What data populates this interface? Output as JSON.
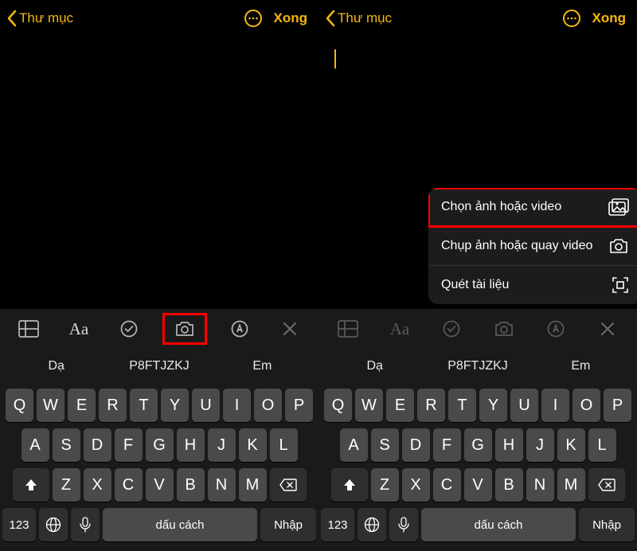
{
  "nav": {
    "back_label": "Thư mục",
    "done_label": "Xong"
  },
  "menu": {
    "item1": "Chọn ảnh hoặc video",
    "item2": "Chụp ảnh hoặc quay video",
    "item3": "Quét tài liệu"
  },
  "toolbar": {
    "aa": "Aa"
  },
  "suggest": {
    "left": "Dạ",
    "mid": "P8FTJZKJ",
    "right": "Em"
  },
  "keys": {
    "r1": [
      "Q",
      "W",
      "E",
      "R",
      "T",
      "Y",
      "U",
      "I",
      "O",
      "P"
    ],
    "r2": [
      "A",
      "S",
      "D",
      "F",
      "G",
      "H",
      "J",
      "K",
      "L"
    ],
    "r3": [
      "Z",
      "X",
      "C",
      "V",
      "B",
      "N",
      "M"
    ],
    "num": "123",
    "space": "dấu cách",
    "enter": "Nhập"
  }
}
